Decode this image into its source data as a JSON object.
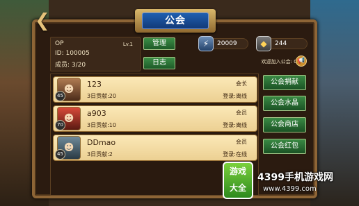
{
  "title": "公会",
  "guild": {
    "name": "OP",
    "level": "Lv.1",
    "id_label": "ID:",
    "id": "100005",
    "members_label": "成员:",
    "members": "3/20"
  },
  "buttons": {
    "manage": "管理",
    "log": "日志"
  },
  "resources": {
    "energy": "20009",
    "gold": "244",
    "energy_icon": "lightning-shield-icon",
    "gold_icon": "gold-shield-icon"
  },
  "welcome": "欢迎加入公会: OP",
  "members_list": [
    {
      "name": "123",
      "contribution": "3日贡献:20",
      "role": "会长",
      "login": "登录:离线",
      "level": "45"
    },
    {
      "name": "a903",
      "contribution": "3日贡献:10",
      "role": "会员",
      "login": "登录:离线",
      "level": "70"
    },
    {
      "name": "DDmao",
      "contribution": "3日贡献:2",
      "role": "会员",
      "login": "登录:在线",
      "level": "45"
    }
  ],
  "side_buttons": [
    "公会捐献",
    "公会水晶",
    "公会商店",
    "公会红包"
  ],
  "watermark": {
    "logo_line1": "游戏",
    "logo_line2": "大全",
    "site_name": "4399手机游戏网",
    "site_url": "www.4399.com"
  }
}
